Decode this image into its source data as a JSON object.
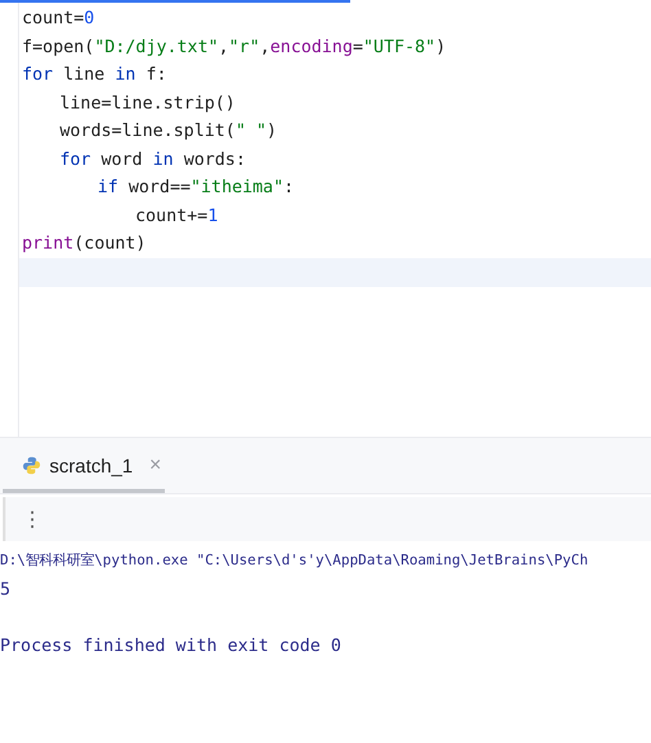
{
  "editor": {
    "lines": [
      {
        "tokens": [
          {
            "text": "count=",
            "kind": "plain"
          },
          {
            "text": "0",
            "kind": "number"
          }
        ]
      },
      {
        "tokens": [
          {
            "text": "f=open(",
            "kind": "plain"
          },
          {
            "text": "\"D:/djy.txt\"",
            "kind": "string"
          },
          {
            "text": ",",
            "kind": "plain"
          },
          {
            "text": "\"r\"",
            "kind": "string"
          },
          {
            "text": ",",
            "kind": "plain"
          },
          {
            "text": "encoding",
            "kind": "param"
          },
          {
            "text": "=",
            "kind": "plain"
          },
          {
            "text": "\"UTF-8\"",
            "kind": "string"
          },
          {
            "text": ")",
            "kind": "plain"
          }
        ]
      },
      {
        "tokens": [
          {
            "text": "for",
            "kind": "keyword"
          },
          {
            "text": " line ",
            "kind": "plain"
          },
          {
            "text": "in",
            "kind": "keyword"
          },
          {
            "text": " f:",
            "kind": "plain"
          }
        ],
        "children": [
          {
            "tokens": [
              {
                "text": "line=line.strip()",
                "kind": "plain"
              }
            ]
          },
          {
            "tokens": [
              {
                "text": "words=line.split(",
                "kind": "plain"
              },
              {
                "text": "\" \"",
                "kind": "string"
              },
              {
                "text": ")",
                "kind": "plain"
              }
            ]
          },
          {
            "tokens": [
              {
                "text": "for",
                "kind": "keyword"
              },
              {
                "text": " word ",
                "kind": "plain"
              },
              {
                "text": "in",
                "kind": "keyword"
              },
              {
                "text": " words:",
                "kind": "plain"
              }
            ],
            "children": [
              {
                "tokens": [
                  {
                    "text": "if",
                    "kind": "keyword"
                  },
                  {
                    "text": " word==",
                    "kind": "plain"
                  },
                  {
                    "text": "\"itheima\"",
                    "kind": "string"
                  },
                  {
                    "text": ":",
                    "kind": "plain"
                  }
                ],
                "children": [
                  {
                    "tokens": [
                      {
                        "text": "count+=",
                        "kind": "plain"
                      },
                      {
                        "text": "1",
                        "kind": "number"
                      }
                    ]
                  }
                ]
              }
            ]
          }
        ]
      },
      {
        "tokens": [
          {
            "text": "print",
            "kind": "builtin"
          },
          {
            "text": "(count)",
            "kind": "plain"
          }
        ]
      }
    ]
  },
  "run_panel": {
    "tab": {
      "label": "scratch_1",
      "close": "×",
      "selected": true
    },
    "menu": "⋮",
    "output": {
      "command": "D:\\智科科研室\\python.exe \"C:\\Users\\d's'y\\AppData\\Roaming\\JetBrains\\PyCh",
      "result": "5",
      "exit_message": "Process finished with exit code 0"
    }
  }
}
